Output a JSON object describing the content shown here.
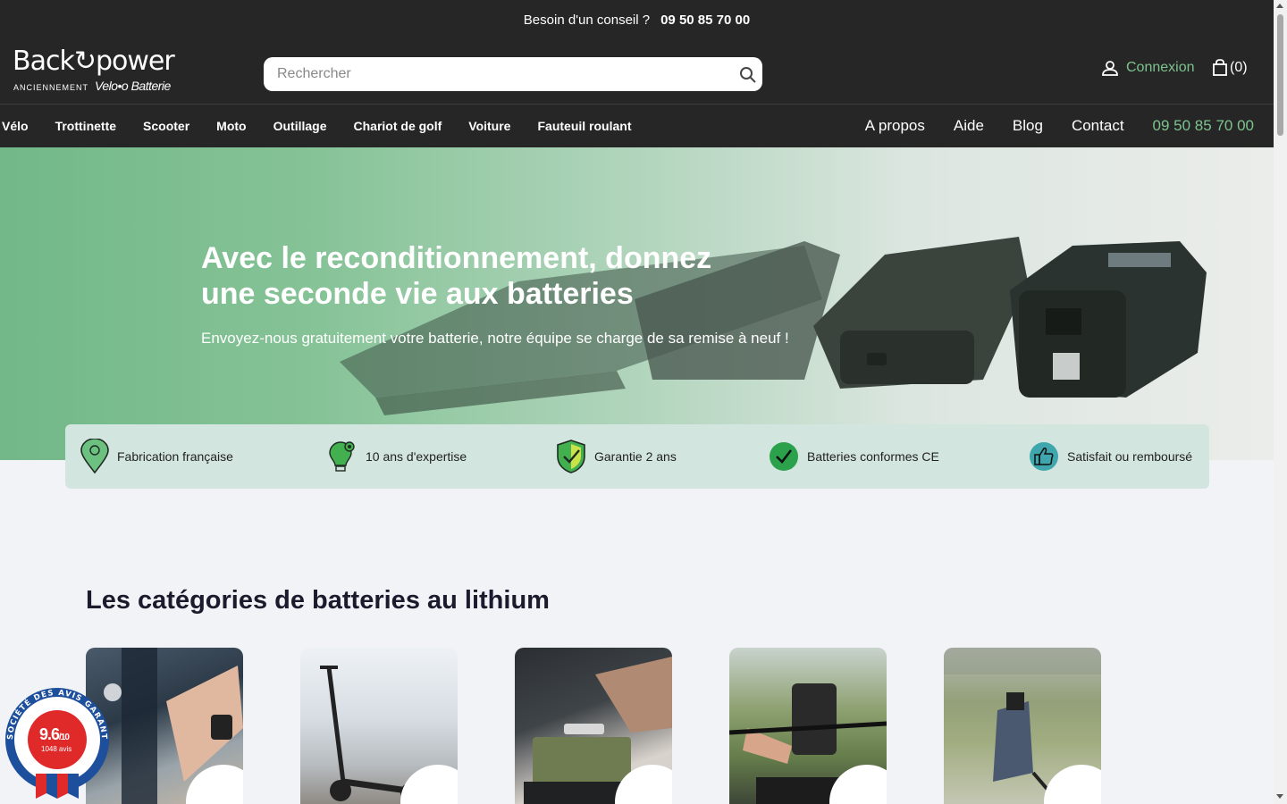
{
  "topbar": {
    "text": "Besoin d'un conseil ?",
    "phone": "09 50 85 70 00"
  },
  "header": {
    "logo": {
      "main": "Back↻power",
      "anciennement": "ANCIENNEMENT",
      "velobatterie": "Velo•o Batterie"
    },
    "search_placeholder": "Rechercher",
    "account_label": "Connexion",
    "cart_label": "(0)"
  },
  "nav": {
    "left": [
      "Vélo",
      "Trottinette",
      "Scooter",
      "Moto",
      "Outillage",
      "Chariot de golf",
      "Voiture",
      "Fauteuil roulant"
    ],
    "right": [
      "A propos",
      "Aide",
      "Blog",
      "Contact"
    ],
    "phone": "09 50 85 70 00"
  },
  "hero": {
    "title": "Avec le reconditionnement, donnez une seconde vie aux batteries",
    "subtitle": "Envoyez-nous gratuitement votre batterie, notre équipe se charge de sa remise à neuf !"
  },
  "features": [
    {
      "label": "Fabrication française",
      "icon": "map-pin-icon"
    },
    {
      "label": "10 ans d'expertise",
      "icon": "lightbulb-gear-icon"
    },
    {
      "label": "Garantie 2 ans",
      "icon": "shield-check-icon"
    },
    {
      "label": "Batteries conformes CE",
      "icon": "check-circle-icon"
    },
    {
      "label": "Satisfait ou remboursé",
      "icon": "thumbs-up-icon"
    }
  ],
  "categories_title": "Les catégories de batteries au lithium",
  "categories": [
    {
      "name": "velo-battery-image"
    },
    {
      "name": "trottinette-image"
    },
    {
      "name": "outillage-image"
    },
    {
      "name": "moto-image"
    },
    {
      "name": "golf-chariot-image"
    }
  ],
  "badge": {
    "arc_text": "SOCIÉTÉ DES AVIS GARANTIS",
    "score": "9.6",
    "out_of": "/10",
    "count": "1048 avis"
  },
  "colors": {
    "dark": "#262626",
    "accent": "#7dc38e",
    "feature_bg": "#d3e5df",
    "page_bg": "#f2f3f7"
  }
}
